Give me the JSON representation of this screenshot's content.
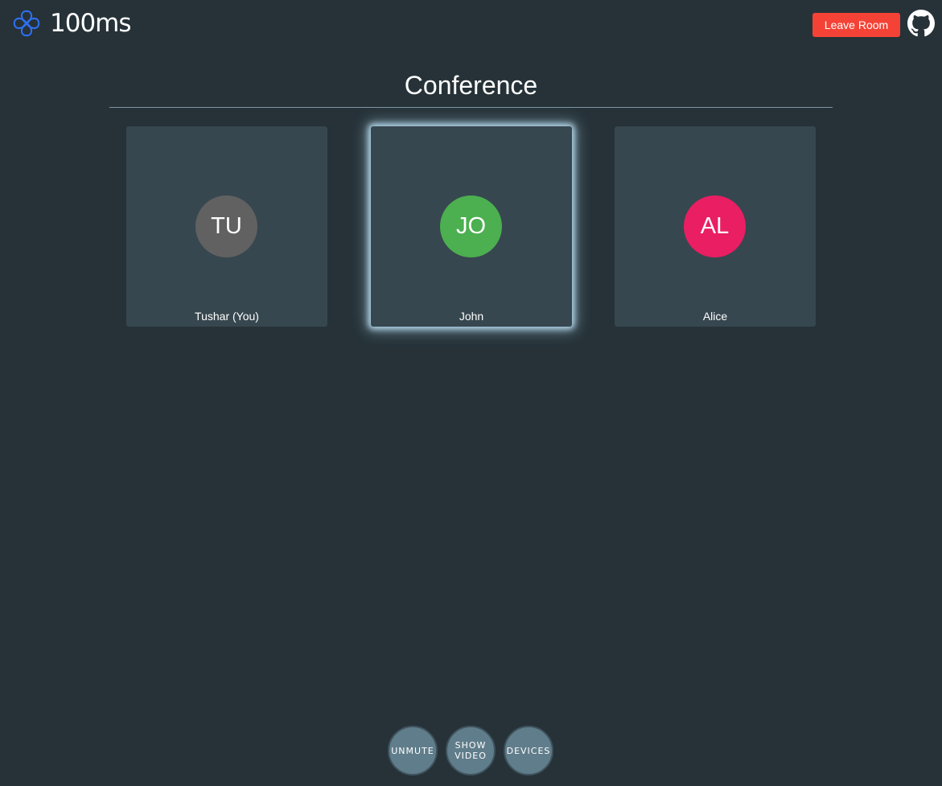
{
  "header": {
    "brand": "100ms",
    "logo_icon": "100ms-logo-icon",
    "leave_label": "Leave Room",
    "github_icon": "github-icon",
    "leave_color": "#f44336",
    "logo_color": "#2f6ff0"
  },
  "main": {
    "title": "Conference",
    "peers": [
      {
        "initials": "TU",
        "name": "Tushar (You)",
        "avatar_color": "#616161",
        "speaking": false
      },
      {
        "initials": "JO",
        "name": "John",
        "avatar_color": "#4caf50",
        "speaking": true
      },
      {
        "initials": "AL",
        "name": "Alice",
        "avatar_color": "#e91e63",
        "speaking": false
      }
    ]
  },
  "controls": {
    "mute_label": "UNMUTE",
    "video_label": "SHOW VIDEO",
    "devices_label": "DEVICES"
  },
  "colors": {
    "background": "#263238",
    "tile": "#37474f",
    "control_button": "#607d8b"
  }
}
